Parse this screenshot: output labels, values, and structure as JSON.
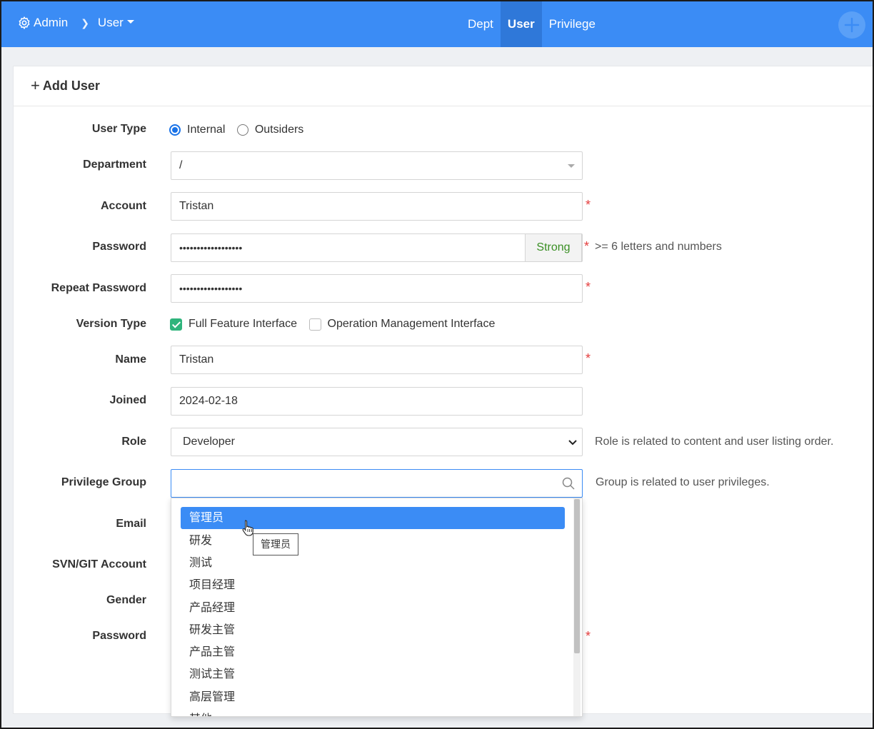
{
  "topbar": {
    "crumb_admin": "Admin",
    "crumb_user": "User",
    "nav": [
      "Dept",
      "User",
      "Privilege"
    ],
    "active_nav": "User",
    "accent": "#3b8cf5"
  },
  "card": {
    "title": "Add User"
  },
  "form": {
    "user_type": {
      "label": "User Type",
      "options": [
        "Internal",
        "Outsiders"
      ],
      "selected": "Internal"
    },
    "department": {
      "label": "Department",
      "value": "/"
    },
    "account": {
      "label": "Account",
      "value": "Tristan"
    },
    "password": {
      "label": "Password",
      "masked": "••••••••••••••••••",
      "strength": "Strong",
      "hint": ">= 6 letters and numbers"
    },
    "repeat_password": {
      "label": "Repeat Password",
      "masked": "••••••••••••••••••"
    },
    "version_type": {
      "label": "Version Type",
      "options": [
        "Full Feature Interface",
        "Operation Management Interface"
      ],
      "checked": "Full Feature Interface"
    },
    "name": {
      "label": "Name",
      "value": "Tristan"
    },
    "joined": {
      "label": "Joined",
      "value": "2024-02-18"
    },
    "role": {
      "label": "Role",
      "value": "Developer",
      "hint": "Role is related to content and user listing order."
    },
    "privilege_group": {
      "label": "Privilege Group",
      "value": "",
      "hint": "Group is related to user privileges."
    },
    "email": {
      "label": "Email"
    },
    "svn_git": {
      "label": "SVN/GIT Account"
    },
    "gender": {
      "label": "Gender"
    },
    "verify_password": {
      "label": "Password"
    }
  },
  "dropdown": {
    "options": [
      "管理员",
      "研发",
      "测试",
      "项目经理",
      "产品经理",
      "研发主管",
      "产品主管",
      "测试主管",
      "高层管理",
      "其他"
    ],
    "highlighted": "管理员",
    "tooltip": "管理员"
  },
  "required_mark": "*"
}
